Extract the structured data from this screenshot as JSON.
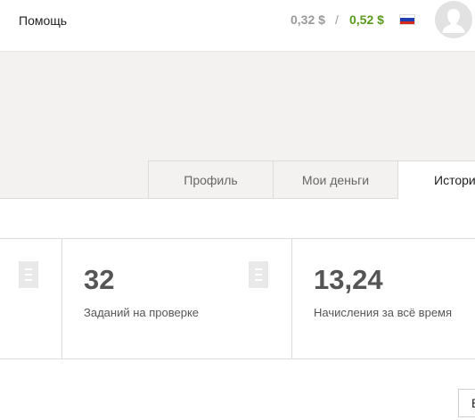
{
  "header": {
    "help_label": "Помощь",
    "balance_pending": "0,32 $",
    "balance_separator": "/",
    "balance_available": "0,52 $",
    "balance_available_color": "#5a9a1e",
    "language_flag": "russia-flag-icon",
    "avatar_icon": "user-avatar-icon"
  },
  "tabs": [
    {
      "label": "Профиль",
      "active": false
    },
    {
      "label": "Мои деньги",
      "active": false
    },
    {
      "label": "Истори",
      "active": true
    }
  ],
  "stats": [
    {
      "value": "32",
      "label": "Заданий на проверке",
      "icon": "document-icon"
    },
    {
      "value": "13,24",
      "label": "Начисления за всё время",
      "icon": "document-icon"
    }
  ],
  "bottom_button": {
    "label": "В"
  }
}
